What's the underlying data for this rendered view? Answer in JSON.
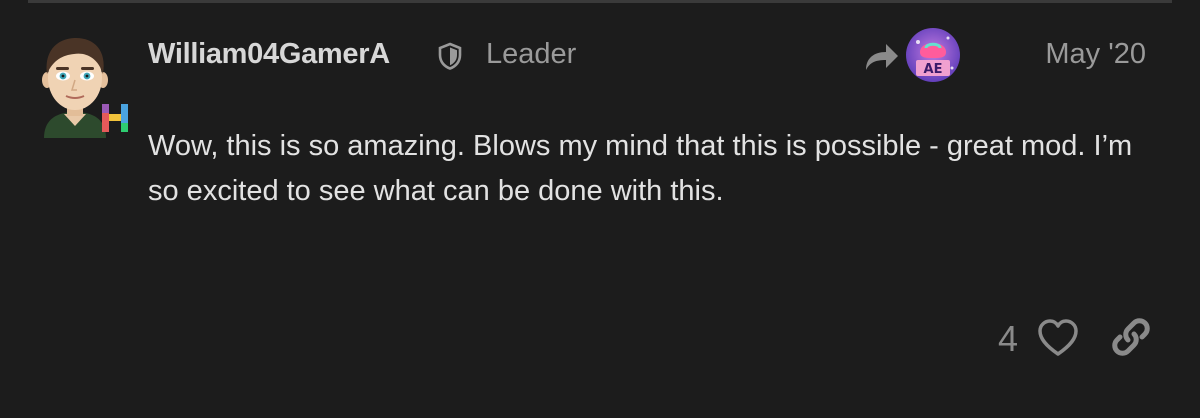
{
  "post": {
    "username": "William04GamerA",
    "user_title": "Leader",
    "date": "May '20",
    "body": "Wow, this is so amazing. Blows my mind that this is possible - great mod. I’m so excited to see what can be done with this.",
    "flair_letter": "H",
    "reply_avatar_text": "AE"
  },
  "actions": {
    "like_count": "4"
  },
  "colors": {
    "background": "#1c1c1c",
    "username": "#d7d7d7",
    "muted": "#9a9a9a",
    "body_text": "#e2e2e2",
    "icon": "#8a8a8a"
  },
  "icons": {
    "moderator": "shield-icon",
    "reply": "reply-arrow-icon",
    "like": "heart-icon",
    "link": "link-icon"
  }
}
